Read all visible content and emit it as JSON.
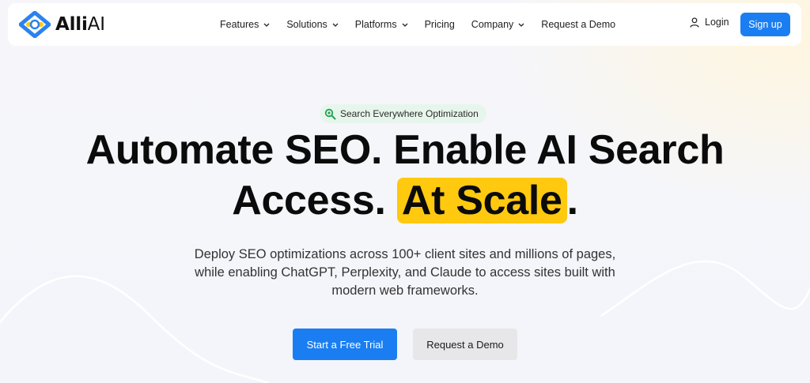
{
  "brand": {
    "name_prefix": "Alli",
    "name_suffix": "AI"
  },
  "nav": {
    "items": [
      {
        "label": "Features",
        "has_dropdown": true
      },
      {
        "label": "Solutions",
        "has_dropdown": true
      },
      {
        "label": "Platforms",
        "has_dropdown": true
      },
      {
        "label": "Pricing",
        "has_dropdown": false
      },
      {
        "label": "Company",
        "has_dropdown": true
      },
      {
        "label": "Request a Demo",
        "has_dropdown": false
      }
    ],
    "login_label": "Login",
    "signup_label": "Sign up"
  },
  "hero": {
    "badge": "Search Everywhere Optimization",
    "headline_line1": "Automate SEO. Enable AI Search",
    "headline_line2_start": "Access.",
    "headline_highlight": "At Scale",
    "headline_line2_end": ".",
    "subtitle": "Deploy SEO optimizations across 100+ client sites and millions of pages, while enabling ChatGPT, Perplexity, and Claude to access sites built with modern web frameworks.",
    "primary_cta": "Start a Free Trial",
    "secondary_cta": "Request a Demo"
  },
  "icons": {
    "logo": "alliai-logo-icon",
    "chevron": "chevron-down-icon",
    "user": "user-icon",
    "badge": "search-magnifier-icon"
  },
  "colors": {
    "accent_blue": "#1a7ef2",
    "highlight_yellow": "#ffc910",
    "badge_bg": "#e7f6ec",
    "badge_icon": "#22a352",
    "logo_blue": "#2a82f0",
    "logo_yellow": "#ffc910"
  }
}
